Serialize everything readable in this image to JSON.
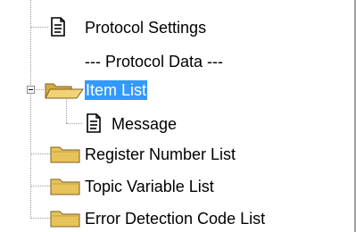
{
  "tree": {
    "items": [
      {
        "label": "Protocol Settings",
        "icon": "document-icon"
      },
      {
        "label": "--- Protocol Data ---",
        "icon": ""
      },
      {
        "label": "Item List",
        "icon": "open-folder-icon",
        "selected": true,
        "expanded": true
      },
      {
        "label": "Message",
        "icon": "document-icon"
      },
      {
        "label": "Register Number List",
        "icon": "folder-icon"
      },
      {
        "label": "Topic Variable List",
        "icon": "folder-icon"
      },
      {
        "label": "Error Detection Code List",
        "icon": "folder-icon"
      }
    ]
  },
  "colors": {
    "selection": "#3399ff",
    "folder": "#e7c35a",
    "connector": "#9a9a9a"
  }
}
